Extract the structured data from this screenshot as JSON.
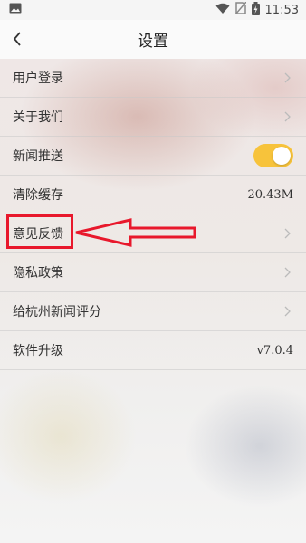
{
  "status": {
    "time": "11:53",
    "icons": [
      "image-icon",
      "wifi-icon",
      "no-sim-icon",
      "battery-icon"
    ]
  },
  "header": {
    "title": "设置",
    "back_icon": "chevron-left-icon"
  },
  "settings": [
    {
      "label": "用户登录",
      "type": "link"
    },
    {
      "label": "关于我们",
      "type": "link"
    },
    {
      "label": "新闻推送",
      "type": "toggle",
      "on": true
    },
    {
      "label": "清除缓存",
      "type": "value",
      "value": "20.43M"
    },
    {
      "label": "意见反馈",
      "type": "link",
      "highlighted": true
    },
    {
      "label": "隐私政策",
      "type": "link"
    },
    {
      "label": "给杭州新闻评分",
      "type": "link"
    },
    {
      "label": "软件升级",
      "type": "value",
      "value": "v7.0.4"
    }
  ],
  "colors": {
    "toggle_on": "#f7c33b",
    "annotation": "#e8182c"
  }
}
